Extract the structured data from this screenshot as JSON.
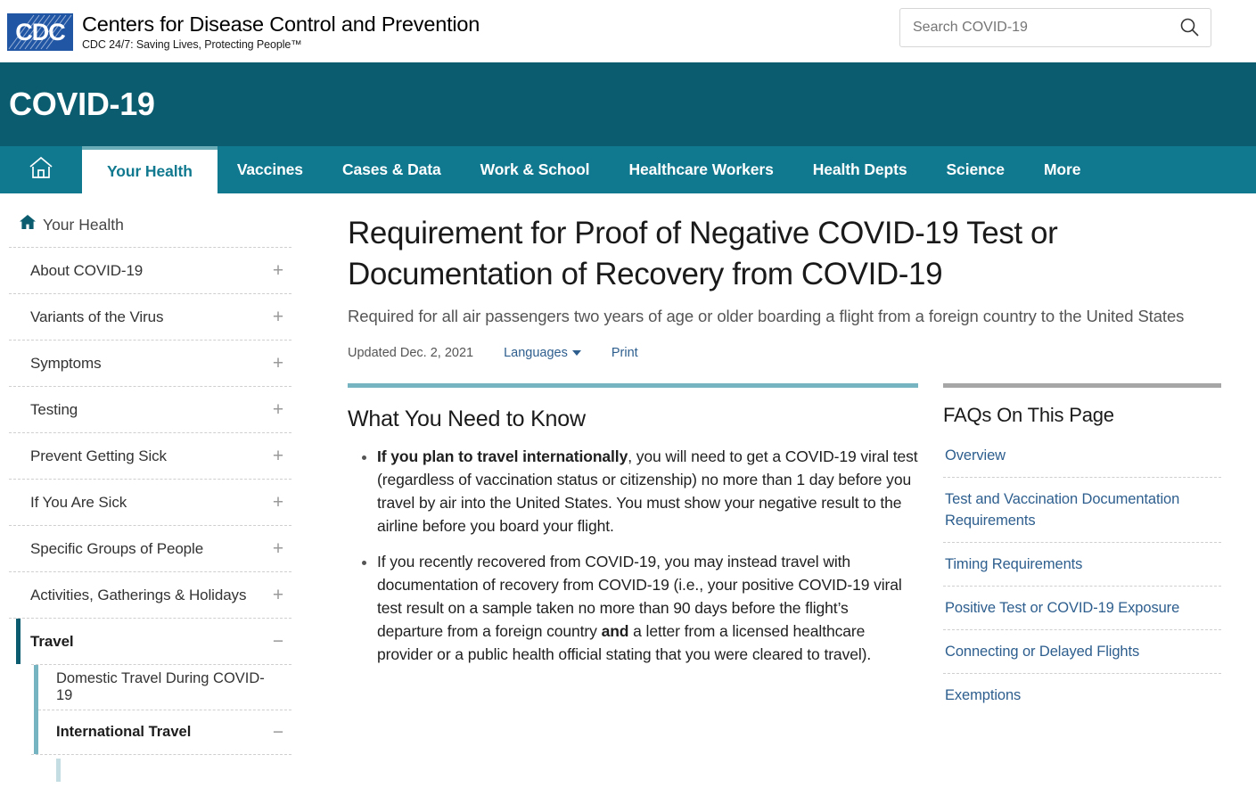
{
  "header": {
    "logo_alt": "CDC",
    "org_name": "Centers for Disease Control and Prevention",
    "tagline": "CDC 24/7: Saving Lives, Protecting People™",
    "search_placeholder": "Search COVID-19",
    "search_value": "",
    "search_icon": "search-icon"
  },
  "banner": {
    "title": "COVID-19",
    "bg_color": "#0b5c6e"
  },
  "nav": {
    "bg_color": "#11798f",
    "home_icon": "home-icon",
    "items": [
      {
        "label": "Your Health",
        "active": true
      },
      {
        "label": "Vaccines",
        "active": false
      },
      {
        "label": "Cases & Data",
        "active": false
      },
      {
        "label": "Work & School",
        "active": false
      },
      {
        "label": "Healthcare Workers",
        "active": false
      },
      {
        "label": "Health Depts",
        "active": false
      },
      {
        "label": "Science",
        "active": false
      },
      {
        "label": "More",
        "active": false
      }
    ]
  },
  "sidebar": {
    "home_label": "Your Health",
    "home_icon": "home-icon",
    "items": [
      {
        "label": "About COVID-19",
        "toggle": "+",
        "active": false
      },
      {
        "label": "Variants of the Virus",
        "toggle": "+",
        "active": false
      },
      {
        "label": "Symptoms",
        "toggle": "+",
        "active": false
      },
      {
        "label": "Testing",
        "toggle": "+",
        "active": false
      },
      {
        "label": "Prevent Getting Sick",
        "toggle": "+",
        "active": false
      },
      {
        "label": "If You Are Sick",
        "toggle": "+",
        "active": false
      },
      {
        "label": "Specific Groups of People",
        "toggle": "+",
        "active": false
      },
      {
        "label": "Activities, Gatherings & Holidays",
        "toggle": "+",
        "active": false
      },
      {
        "label": "Travel",
        "toggle": "−",
        "active": true
      }
    ],
    "subitems": [
      {
        "label": "Domestic Travel During COVID-19",
        "toggle": "",
        "current": false
      },
      {
        "label": "International Travel",
        "toggle": "−",
        "current": true
      }
    ],
    "active_accent": "#0b5c6e",
    "sub_accent": "#75b4c0"
  },
  "main": {
    "title": "Requirement for Proof of Negative COVID-19 Test or Documentation of Recovery from COVID-19",
    "subtitle": "Required for all air passengers two years of age or older boarding a flight from a foreign country to the United States",
    "updated": "Updated Dec. 2, 2021",
    "languages_label": "Languages",
    "languages_icon": "chevron-down-icon",
    "print_label": "Print",
    "what_you_need_to_know": {
      "heading": "What You Need to Know",
      "rule_color": "#75b4c0",
      "bullets": [
        {
          "bold_lead": "If you plan to travel internationally",
          "rest": ", you will need to get a COVID-19 viral test (regardless of vaccination status or citizenship) no more than 1 day before you travel by air into the United States. You must show your negative result to the airline before you board your flight."
        },
        {
          "part1": "If you recently recovered from COVID-19, you may instead travel with documentation of recovery from COVID-19 (i.e., your positive COVID-19 viral test result on a sample taken no more than 90 days before the flight’s departure from a foreign country ",
          "bold_mid": "and",
          "part2": " a letter from a licensed healthcare provider or a public health official stating that you were cleared to travel)."
        }
      ]
    }
  },
  "faq": {
    "heading": "FAQs On This Page",
    "rule_color": "#a6a6a6",
    "link_color": "#2d5e8e",
    "links": [
      "Overview",
      "Test and Vaccination Documentation Requirements",
      "Timing Requirements",
      "Positive Test or COVID-19 Exposure",
      "Connecting or Delayed Flights",
      "Exemptions"
    ]
  }
}
